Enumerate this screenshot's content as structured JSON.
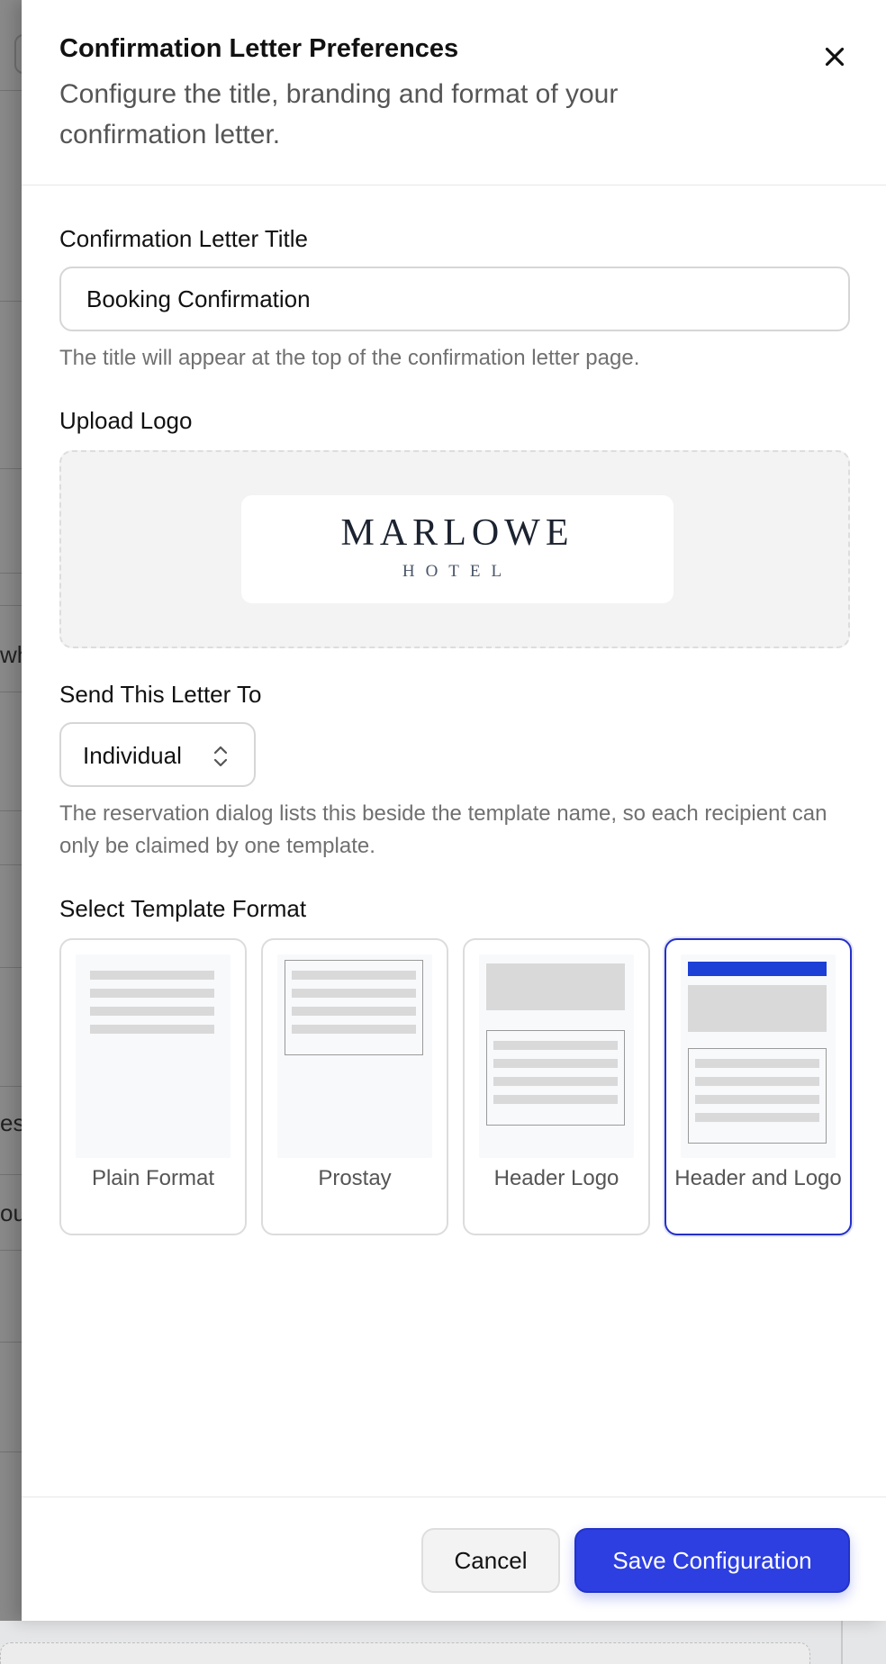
{
  "dialog": {
    "title": "Confirmation Letter Preferences",
    "subtitle": "Configure the title, branding and format of your confirmation letter."
  },
  "letter_title": {
    "label": "Confirmation Letter Title",
    "value": "Booking Confirmation",
    "help": "The title will appear at the top of the confirmation letter page."
  },
  "logo": {
    "label": "Upload Logo",
    "brand_name": "MARLOWE",
    "brand_sub": "HOTEL"
  },
  "send_to": {
    "label": "Send This Letter To",
    "selected": "Individual",
    "help": "The reservation dialog lists this beside the template name, so each recipient can only be claimed by one template."
  },
  "template_format": {
    "label": "Select Template Format",
    "options": [
      {
        "label": "Plain Format",
        "selected": false
      },
      {
        "label": "Prostay",
        "selected": false
      },
      {
        "label": "Header Logo",
        "selected": false
      },
      {
        "label": "Header and Logo",
        "selected": true
      }
    ]
  },
  "footer": {
    "cancel_label": "Cancel",
    "save_label": "Save Configuration"
  },
  "background_fragments": [
    "wh",
    "ese",
    "ou"
  ],
  "colors": {
    "accent": "#2d3fe0",
    "selected_border": "#2430c8",
    "header_bar": "#1c3fd6"
  }
}
